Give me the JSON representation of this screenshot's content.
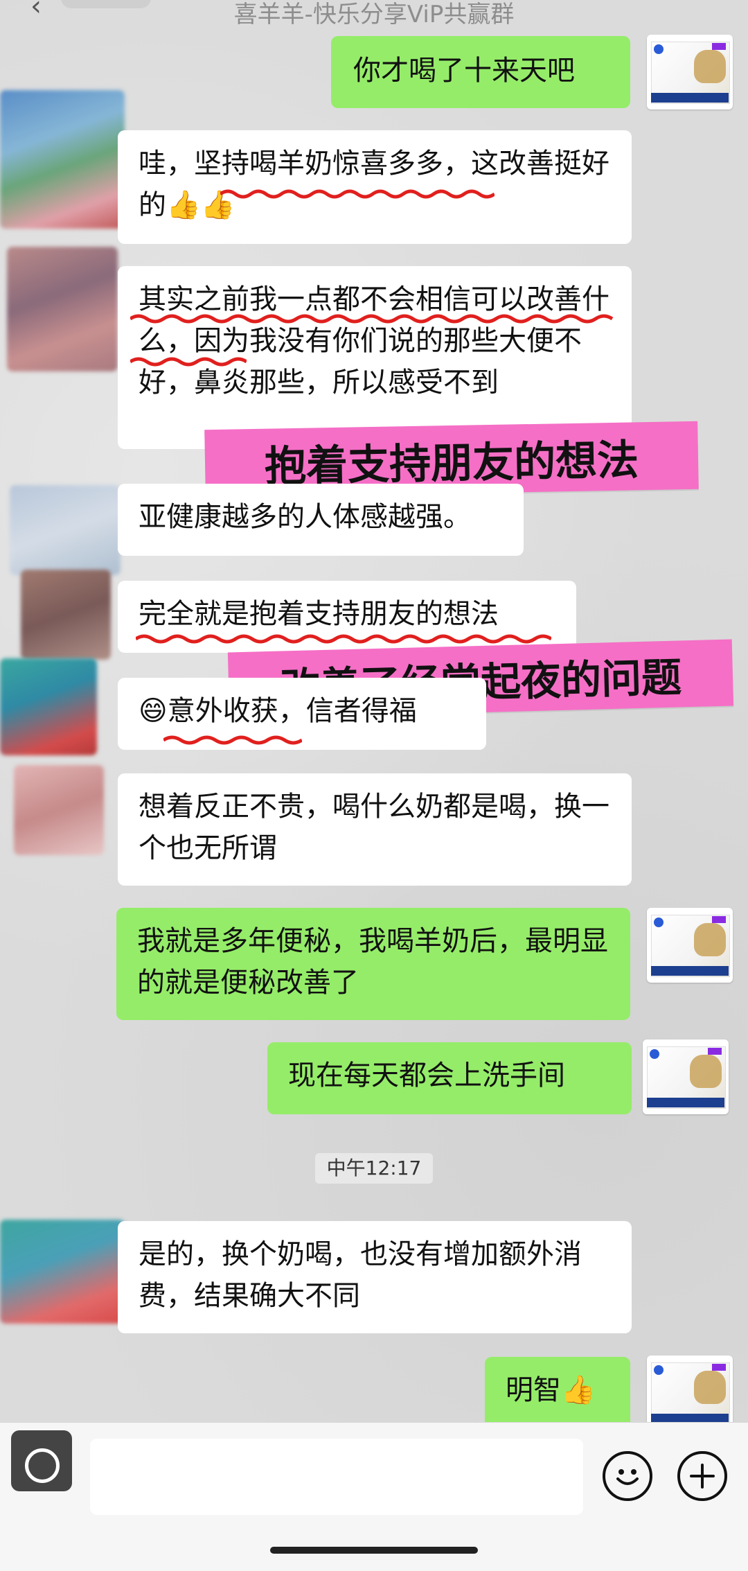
{
  "header": {
    "title": "喜羊羊-快乐分享ViP共赢群",
    "back_icon": "chevron-left-icon"
  },
  "messages": [
    {
      "id": "m1",
      "side": "out",
      "text": "你才喝了十来天吧"
    },
    {
      "id": "m2",
      "side": "in",
      "text": "哇，坚持喝羊奶惊喜多多，这改善挺好的👍👍"
    },
    {
      "id": "m3",
      "side": "in",
      "text": "其实之前我一点都不会相信可以改善什么，因为我没有你们说的那些大便不好，鼻炎那些，所以感受不到"
    },
    {
      "id": "m4",
      "side": "in",
      "text": "亚健康越多的人体感越强。"
    },
    {
      "id": "m5",
      "side": "in",
      "text": "完全就是抱着支持朋友的想法"
    },
    {
      "id": "m6",
      "side": "in",
      "text": "😄意外收获，信者得福"
    },
    {
      "id": "m7",
      "side": "in",
      "text": "想着反正不贵，喝什么奶都是喝，换一个也无所谓"
    },
    {
      "id": "m8",
      "side": "out",
      "text": "我就是多年便秘，我喝羊奶后，最明显的就是便秘改善了"
    },
    {
      "id": "m9",
      "side": "out",
      "text": "现在每天都会上洗手间"
    },
    {
      "id": "m10",
      "side": "in",
      "text": "是的，换个奶喝，也没有增加额外消费，结果确大不同"
    },
    {
      "id": "m11",
      "side": "out",
      "text": "明智👍"
    }
  ],
  "timestamp": "中午12:17",
  "stickers": [
    {
      "id": "s1",
      "text": "抱着支持朋友的想法"
    },
    {
      "id": "s2",
      "text": "改善了经常起夜的问题"
    }
  ],
  "colors": {
    "bubble_out": "#95ec69",
    "bubble_in": "#ffffff",
    "sticker": "#f56fc6",
    "underline": "#e0201e"
  },
  "input_bar": {
    "voice_icon": "voice-icon",
    "emoji_icon": "emoji-icon",
    "plus_icon": "plus-icon"
  }
}
